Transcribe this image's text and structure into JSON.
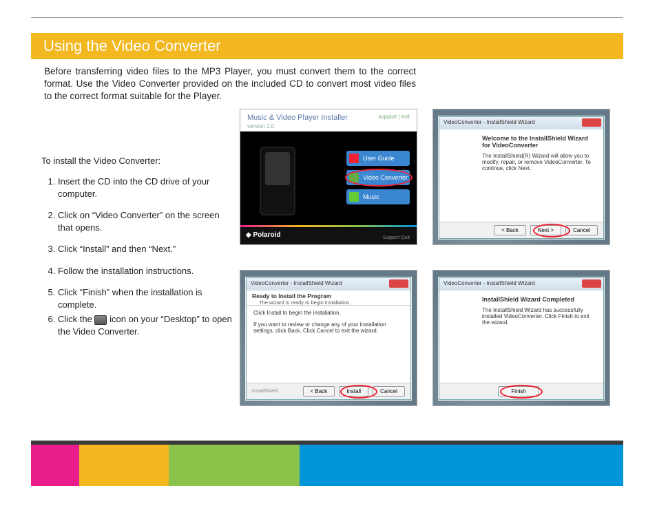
{
  "title": "Using the Video Converter",
  "intro": "Before transferring video files to the MP3 Player, you must convert them to the correct format.  Use the Video Converter provided on the included CD to convert most video files to the correct format suitable for the Player.",
  "install_lead": "To install the Video Converter:",
  "steps": {
    "s1": "Insert the CD into the CD drive of your computer.",
    "s2": "Click on “Video Converter” on the screen that opens.",
    "s3": "Click “Install” and then “Next.”",
    "s4": "Follow the installation instructions.",
    "s5": "Click “Finish” when the installation is complete.",
    "s6a": "Click the",
    "s6b": "icon on your “Desktop” to open the Video Converter."
  },
  "installer": {
    "title": "Music & Video Player Installer",
    "subtitle": "version 1.0",
    "topright": "support | exit",
    "btn_user_guide": "User Guide",
    "btn_video_conv": "Video Converter",
    "btn_music": "Music",
    "logo": "◆ Polaroid",
    "footer_right": "Support     Quit"
  },
  "wizard_b": {
    "window_title": "VideoConverter - InstallShield Wizard",
    "heading": "Welcome to the InstallShield Wizard for VideoConverter",
    "body": "The InstallShield(R) Wizard will allow you to modify, repair, or remove VideoConverter. To continue, click Next.",
    "back": "< Back",
    "next": "Next >",
    "cancel": "Cancel"
  },
  "wizard_c": {
    "window_title": "VideoConverter - InstallShield Wizard",
    "heading": "Ready to Install the Program",
    "sub": "The wizard is ready to begin installation.",
    "line1": "Click Install to begin the installation.",
    "line2": "If you want to review or change any of your installation settings, click Back. Click Cancel to exit the wizard.",
    "footer_brand": "InstallShield",
    "back": "< Back",
    "install": "Install",
    "cancel": "Cancel"
  },
  "wizard_d": {
    "window_title": "VideoConverter - InstallShield Wizard",
    "heading": "InstallShield Wizard Completed",
    "body": "The InstallShield Wizard has successfully installed VideoConverter. Click Finish to exit the wizard.",
    "finish": "Finish"
  }
}
